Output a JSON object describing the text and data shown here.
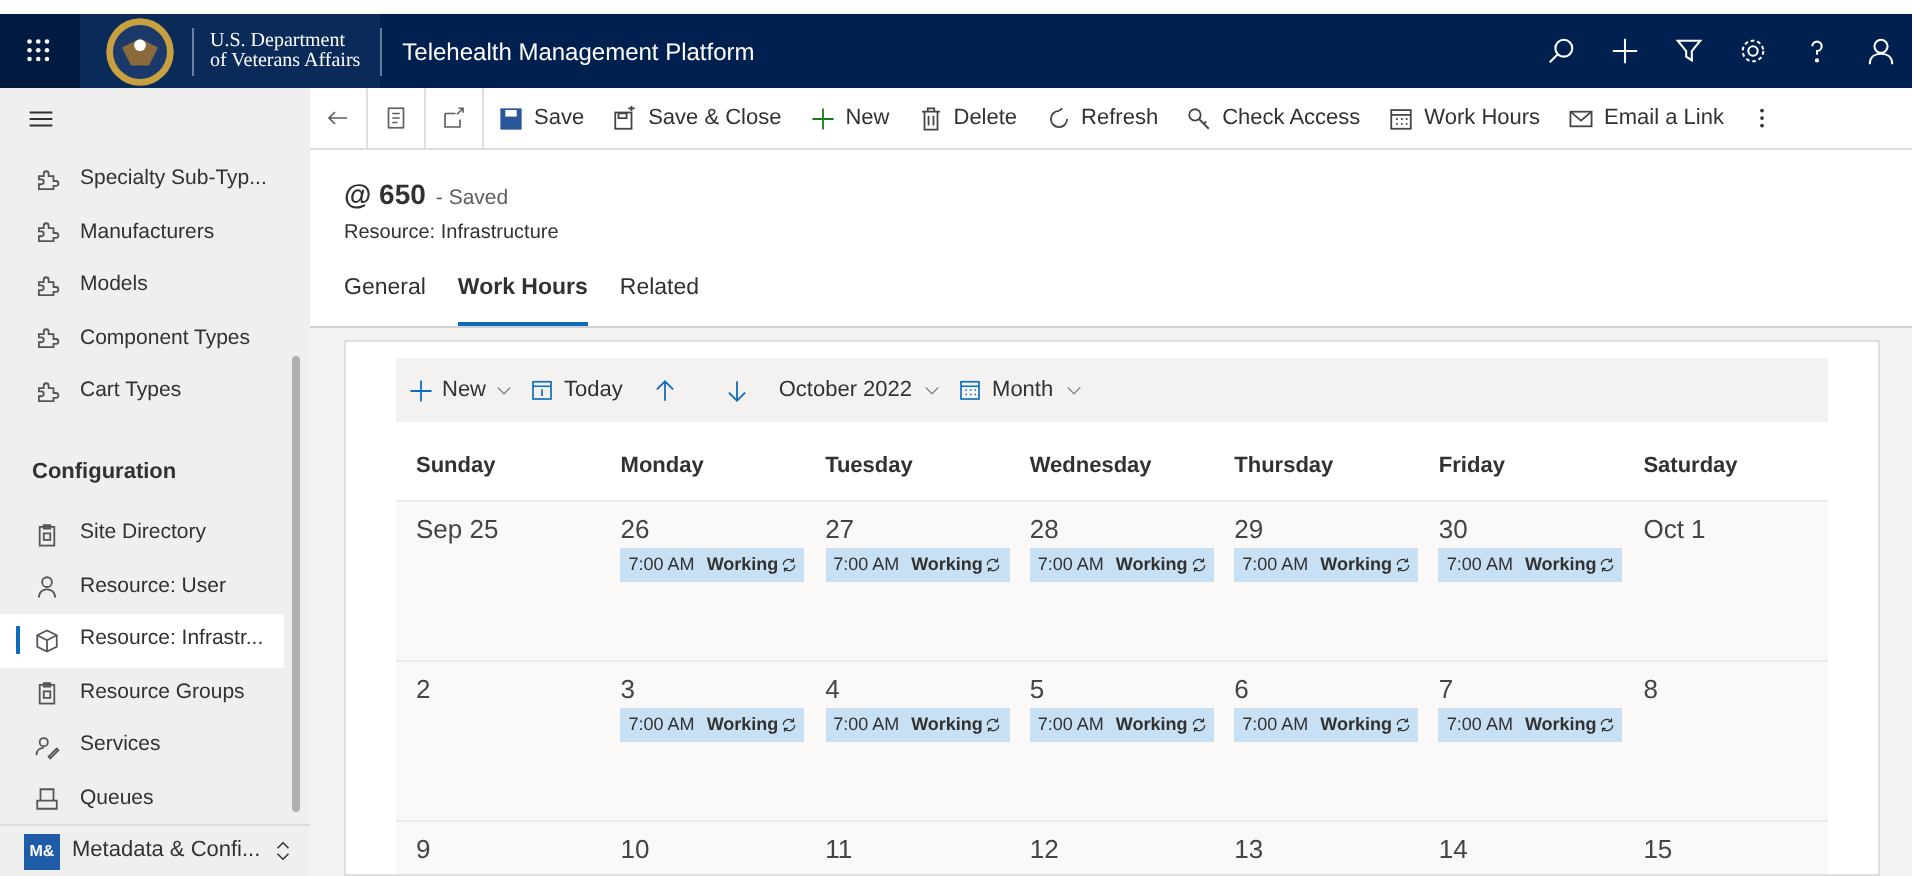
{
  "header": {
    "org_line_1": "U.S. Department",
    "org_line_2": "of Veterans Affairs",
    "app_title": "Telehealth Management Platform"
  },
  "sidebar": {
    "groups": [
      {
        "items": [
          {
            "label": "Specialty Sub-Typ...",
            "selected": false
          },
          {
            "label": "Manufacturers",
            "selected": false
          },
          {
            "label": "Models",
            "selected": false
          },
          {
            "label": "Component Types",
            "selected": false
          },
          {
            "label": "Cart Types",
            "selected": false
          }
        ]
      },
      {
        "heading": "Configuration",
        "items": [
          {
            "label": "Site Directory",
            "selected": false
          },
          {
            "label": "Resource: User",
            "selected": false
          },
          {
            "label": "Resource: Infrastr...",
            "selected": true
          },
          {
            "label": "Resource Groups",
            "selected": false
          },
          {
            "label": "Services",
            "selected": false
          },
          {
            "label": "Queues",
            "selected": false
          }
        ]
      }
    ],
    "area": {
      "badge": "M&",
      "label": "Metadata & Confi..."
    }
  },
  "command_bar": [
    "Save",
    "Save & Close",
    "New",
    "Delete",
    "Refresh",
    "Check Access",
    "Work Hours",
    "Email a Link"
  ],
  "record": {
    "title": "@ 650",
    "status": "- Saved",
    "entity": "Resource: Infrastructure"
  },
  "tabs": [
    {
      "label": "General",
      "selected": false
    },
    {
      "label": "Work Hours",
      "selected": true
    },
    {
      "label": "Related",
      "selected": false
    }
  ],
  "calendar": {
    "new": "New",
    "today": "Today",
    "period": "October 2022",
    "view": "Month",
    "weekdays": [
      "Sunday",
      "Monday",
      "Tuesday",
      "Wednesday",
      "Thursday",
      "Friday",
      "Saturday"
    ],
    "weeks": [
      {
        "days": [
          {
            "date": "Sep 25"
          },
          {
            "date": "26",
            "events": [
              {
                "time": "7:00 AM",
                "label": "Working"
              }
            ]
          },
          {
            "date": "27",
            "events": [
              {
                "time": "7:00 AM",
                "label": "Working"
              }
            ]
          },
          {
            "date": "28",
            "events": [
              {
                "time": "7:00 AM",
                "label": "Working"
              }
            ]
          },
          {
            "date": "29",
            "events": [
              {
                "time": "7:00 AM",
                "label": "Working"
              }
            ]
          },
          {
            "date": "30",
            "events": [
              {
                "time": "7:00 AM",
                "label": "Working"
              }
            ]
          },
          {
            "date": "Oct 1"
          }
        ]
      },
      {
        "days": [
          {
            "date": "2"
          },
          {
            "date": "3",
            "events": [
              {
                "time": "7:00 AM",
                "label": "Working"
              }
            ]
          },
          {
            "date": "4",
            "events": [
              {
                "time": "7:00 AM",
                "label": "Working"
              }
            ]
          },
          {
            "date": "5",
            "events": [
              {
                "time": "7:00 AM",
                "label": "Working"
              }
            ]
          },
          {
            "date": "6",
            "events": [
              {
                "time": "7:00 AM",
                "label": "Working"
              }
            ]
          },
          {
            "date": "7",
            "events": [
              {
                "time": "7:00 AM",
                "label": "Working"
              }
            ]
          },
          {
            "date": "8"
          }
        ]
      },
      {
        "days": [
          {
            "date": "9"
          },
          {
            "date": "10"
          },
          {
            "date": "11"
          },
          {
            "date": "12"
          },
          {
            "date": "13"
          },
          {
            "date": "14"
          },
          {
            "date": "15"
          }
        ]
      }
    ]
  }
}
